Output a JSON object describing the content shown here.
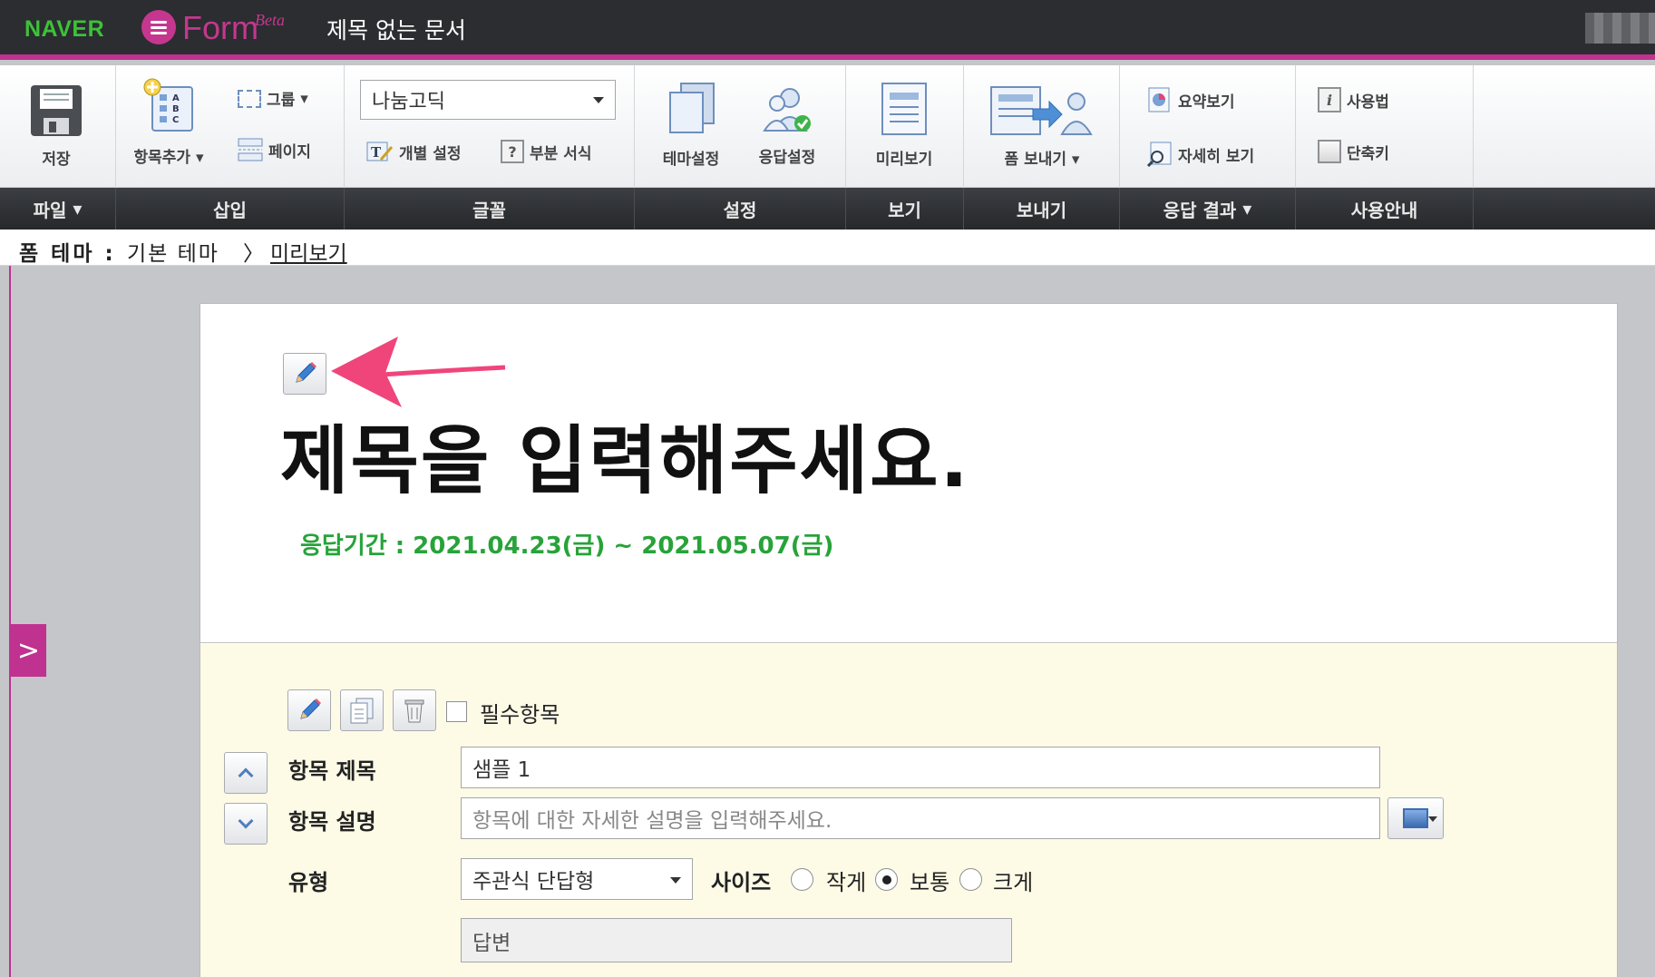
{
  "app": {
    "brand": "NAVER",
    "product": "Form",
    "beta": "Beta",
    "document_title": "제목 없는 문서"
  },
  "ribbon": {
    "save": "저장",
    "add_item": "항목추가",
    "group": "그룹",
    "page": "페이지",
    "font_select": "나눔고딕",
    "individual_setting": "개별 설정",
    "partial_format": "부분 서식",
    "theme_setting": "테마설정",
    "response_setting": "응답설정",
    "preview": "미리보기",
    "send_form": "폼 보내기",
    "summary_view": "요약보기",
    "detail_view": "자세히 보기",
    "usage": "사용법",
    "shortcut": "단축키"
  },
  "groups": {
    "file": "파일",
    "insert": "삽입",
    "font": "글꼴",
    "setting": "설정",
    "view": "보기",
    "send": "보내기",
    "response_result": "응답 결과",
    "guide": "사용안내"
  },
  "breadcrumb": {
    "label": "폼 테마 :",
    "theme": "기본 테마",
    "separator": "〉",
    "preview_link": "미리보기"
  },
  "form": {
    "title": "제목을 입력해주세요.",
    "period": "응답기간 : 2021.04.23(금) ~ 2021.05.07(금)",
    "required_label": "필수항목",
    "item_title_label": "항목 제목",
    "item_title_value": "샘플 1",
    "item_desc_label": "항목 설명",
    "item_desc_placeholder": "항목에 대한 자세한 설명을 입력해주세요.",
    "type_label": "유형",
    "type_value": "주관식 단답형",
    "size_label": "사이즈",
    "size_small": "작게",
    "size_normal": "보통",
    "size_large": "크게",
    "answer_placeholder": "답변",
    "selected_size": "보통"
  },
  "colors": {
    "accent": "#c0328f",
    "naver_green": "#3ec13a",
    "period_green": "#27a339",
    "item_background": "#fdfae6"
  }
}
